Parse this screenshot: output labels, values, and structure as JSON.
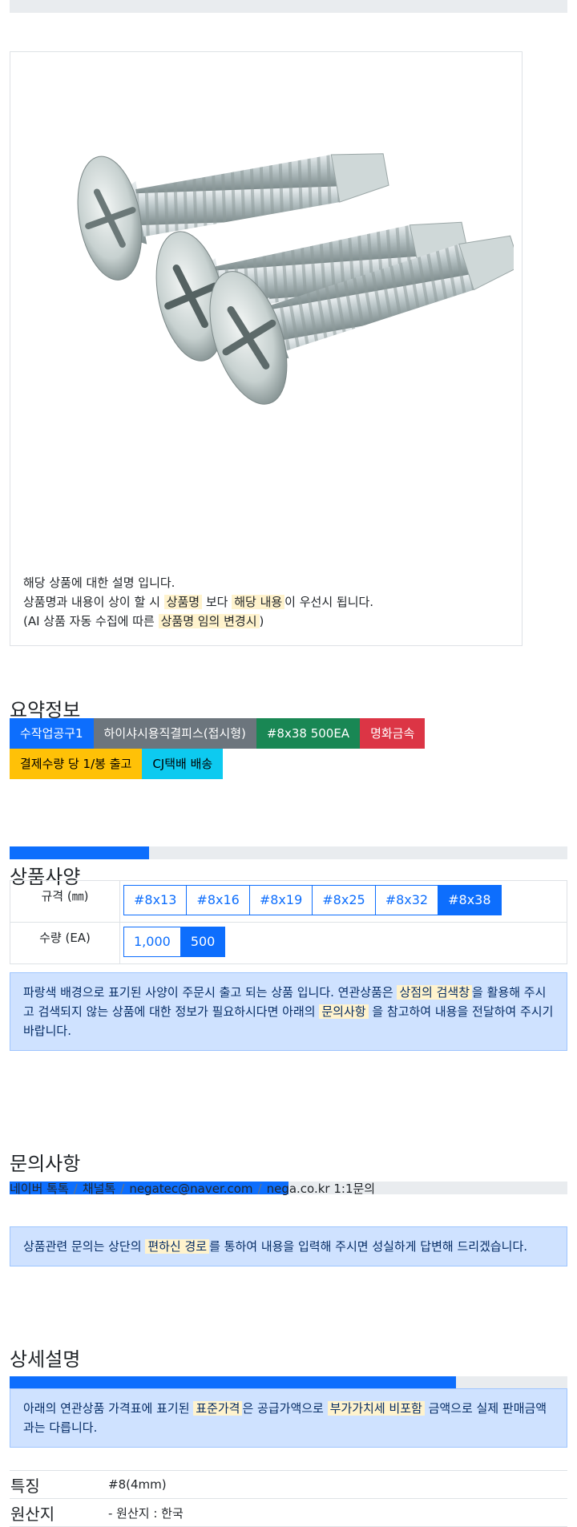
{
  "description": {
    "line1": "해당 상품에 대한 설명 입니다.",
    "line2_pre": "상품명과 내용이 상이 할 시 ",
    "line2_hl1": "상품명",
    "line2_mid": " 보다 ",
    "line2_hl2": "해당 내용",
    "line2_post": "이 우선시 됩니다.",
    "line3_pre": "(AI 상품 자동 수집에 따른 ",
    "line3_hl": "상품명 임의 변경시",
    "line3_post": ")"
  },
  "summary": {
    "title": "요약정보",
    "tags": [
      {
        "label": "수작업공구1",
        "color": "#0d6efd",
        "text_color": "#ffffff"
      },
      {
        "label": "하이샤시용직결피스(접시형)",
        "color": "#6c757d",
        "text_color": "#ffffff"
      },
      {
        "label": "#8x38 500EA",
        "color": "#198754",
        "text_color": "#ffffff"
      },
      {
        "label": "명화금속",
        "color": "#dc3545",
        "text_color": "#ffffff"
      },
      {
        "label": "결제수량 당 1/봉 출고",
        "color": "#ffc107",
        "text_color": "#000000"
      },
      {
        "label": "CJ택배 배송",
        "color": "#0dcaf0",
        "text_color": "#000000"
      }
    ]
  },
  "spec": {
    "title": "상품사양",
    "progress": 0.25,
    "size_label": "규격 (㎜)",
    "size_options": [
      "#8x13",
      "#8x16",
      "#8x19",
      "#8x25",
      "#8x32",
      "#8x38"
    ],
    "size_selected": 5,
    "qty_label": "수량 (EA)",
    "qty_options": [
      "1,000",
      "500"
    ],
    "qty_selected": 1,
    "notice_1": "파랑색 배경으로 표기된 사양이 주문시 출고 되는 상품 입니다. 연관상품은 ",
    "notice_hl1": "상점의 검색창",
    "notice_2": "을 활용해 주시고 검색되지 않는 상품에 대한 정보가 필요하시다면 아래의 ",
    "notice_hl2": "문의사항",
    "notice_3": " 을 참고하여 내용을 전달하여 주시기 바랍니다."
  },
  "inquiry": {
    "title": "문의사항",
    "progress": 0.5,
    "crumbs": [
      "네이버 톡톡",
      "채널톡",
      "negatec@naver.com",
      "nega.co.kr 1:1문의"
    ],
    "notice_1": "상품관련 문의는 상단의 ",
    "notice_hl": "편하신 경로",
    "notice_2": "를 통하여 내용을 입력해 주시면 성실하게 답변해 드리겠습니다."
  },
  "detail": {
    "title": "상세설명",
    "progress": 0.8,
    "notice_1": "아래의 연관상품 가격표에 표기된 ",
    "notice_hl1": "표준가격",
    "notice_2": "은 공급가액으로 ",
    "notice_hl2": "부가가치세 비포함",
    "notice_3": " 금액으로 실제 판매금액과는 다릅니다.",
    "rows": [
      {
        "key": "특징",
        "value": "#8(4mm)"
      },
      {
        "key": "원산지",
        "value": "- 원산지 : 한국"
      }
    ]
  }
}
